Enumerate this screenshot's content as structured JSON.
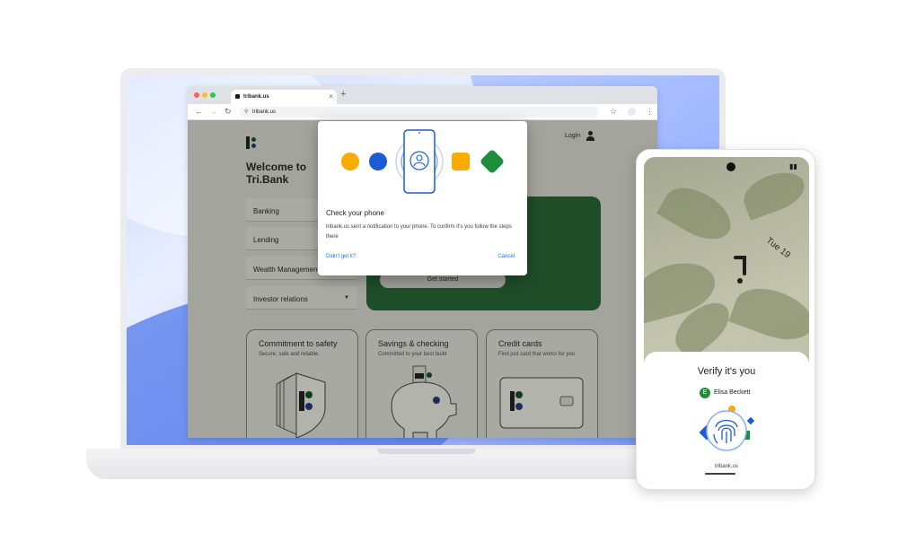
{
  "browser": {
    "tab_title": "tribank.us",
    "url": "tribank.us",
    "new_tab_symbol": "+",
    "close_symbol": "×"
  },
  "page": {
    "welcome": "Welcome to Tri.Bank",
    "menu": [
      {
        "label": "Banking"
      },
      {
        "label": "Lending"
      },
      {
        "label": "Wealth Management"
      },
      {
        "label": "Investor relations"
      }
    ],
    "login_label": "Login",
    "get_started_label": "Get started",
    "cards": [
      {
        "title": "Commitment to safety",
        "subtitle": "Secure, safe and reliable"
      },
      {
        "title": "Savings & checking",
        "subtitle": "Committed to your best build"
      },
      {
        "title": "Credit cards",
        "subtitle": "Find just card that works for you"
      }
    ]
  },
  "dialog": {
    "title": "Check your phone",
    "body": "tribank.us sent a notification to your phone. To confirm it's you follow the steps there",
    "didnt_get_it": "Didn't get it?",
    "cancel": "Cancel"
  },
  "phone": {
    "date": "Tue 19",
    "verify_title": "Verify it's you",
    "avatar_initial": "E",
    "user_name": "Elisa Beckett",
    "site": "tribank.us"
  },
  "colors": {
    "accent_blue": "#1a73e8",
    "google_blue": "#1a5bd6",
    "google_yellow": "#f9ab00",
    "google_green": "#1e8e3e",
    "hero_green": "#1f4d27"
  }
}
